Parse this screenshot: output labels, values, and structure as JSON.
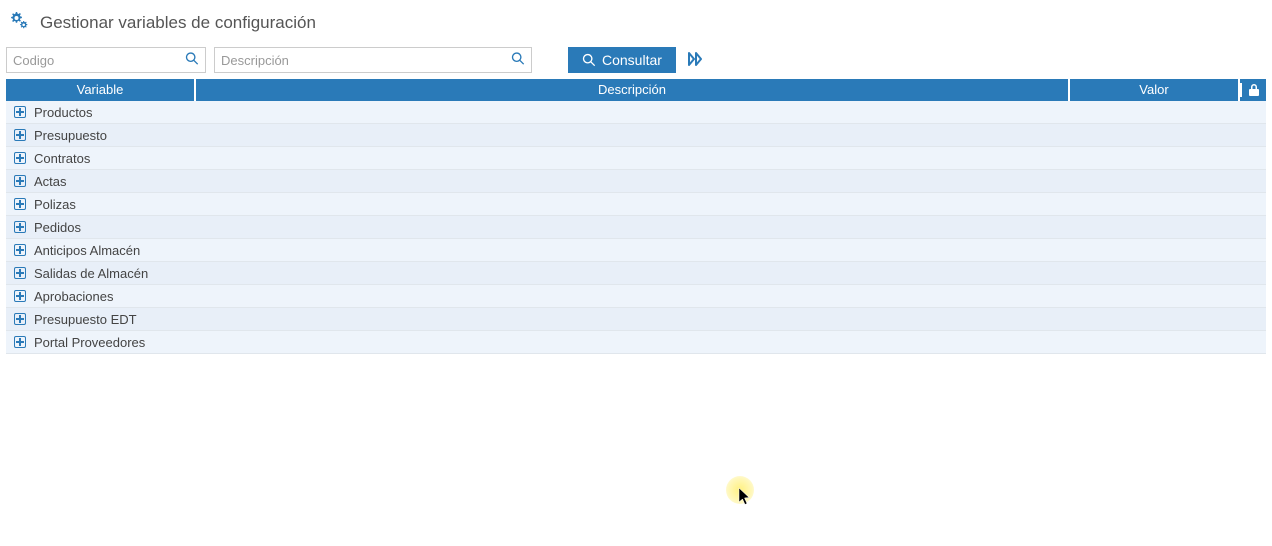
{
  "header": {
    "title": "Gestionar variables de configuración"
  },
  "toolbar": {
    "codigo_placeholder": "Codigo",
    "descripcion_placeholder": "Descripción",
    "consultar_label": "Consultar"
  },
  "table": {
    "columns": {
      "variable": "Variable",
      "descripcion": "Descripción",
      "valor": "Valor"
    },
    "rows": [
      {
        "label": "Productos"
      },
      {
        "label": "Presupuesto"
      },
      {
        "label": "Contratos"
      },
      {
        "label": "Actas"
      },
      {
        "label": "Polizas"
      },
      {
        "label": "Pedidos"
      },
      {
        "label": "Anticipos Almacén"
      },
      {
        "label": "Salidas de Almacén"
      },
      {
        "label": "Aprobaciones"
      },
      {
        "label": "Presupuesto EDT"
      },
      {
        "label": "Portal Proveedores"
      }
    ]
  }
}
